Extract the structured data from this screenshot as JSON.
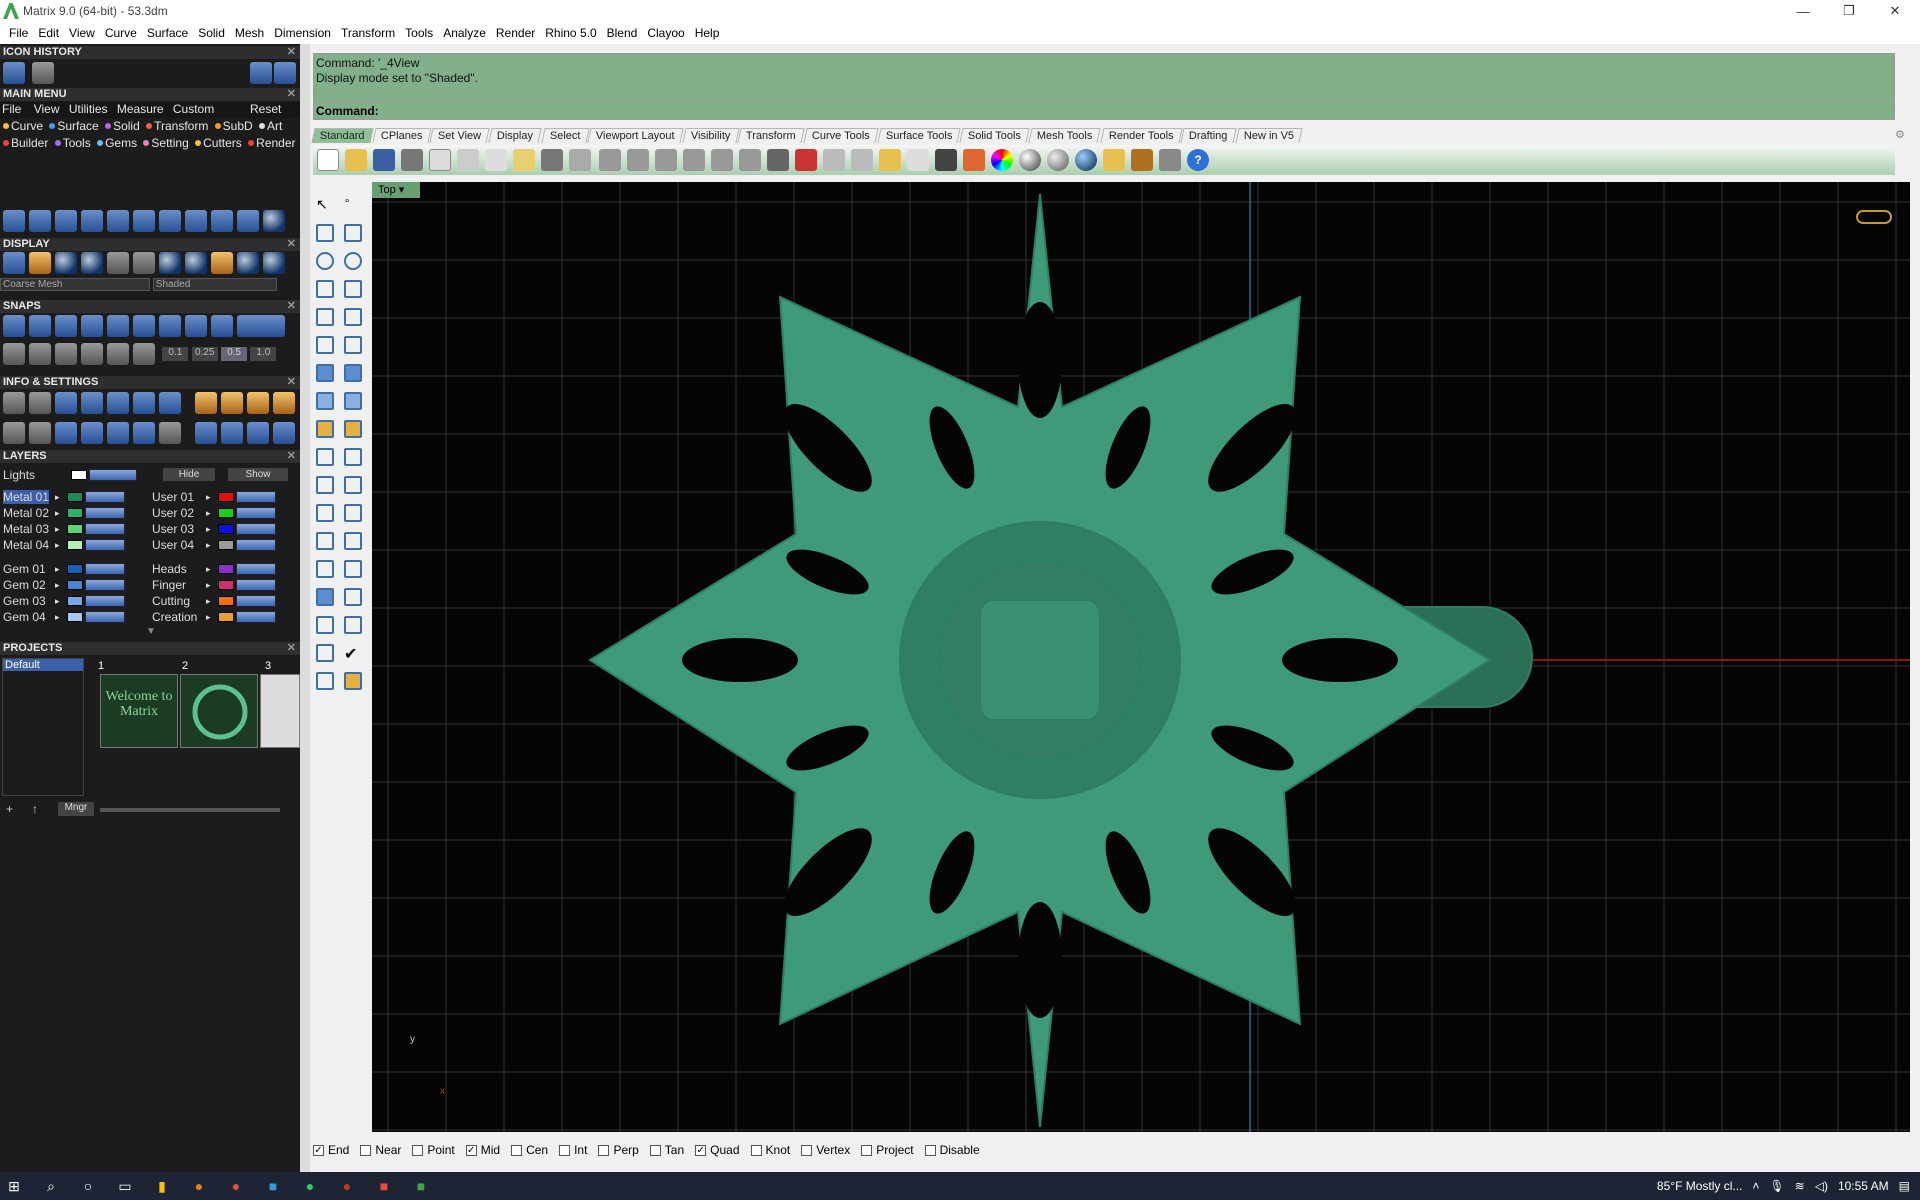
{
  "window": {
    "title": "Matrix 9.0 (64-bit) - 53.3dm",
    "minimize_icon": "minimize-icon",
    "restore_icon": "restore-icon",
    "close_icon": "close-icon"
  },
  "menu": [
    "File",
    "Edit",
    "View",
    "Curve",
    "Surface",
    "Solid",
    "Mesh",
    "Dimension",
    "Transform",
    "Tools",
    "Analyze",
    "Render",
    "Rhino 5.0",
    "Blend",
    "Clayoo",
    "Help"
  ],
  "panels": {
    "icon_history": "ICON HISTORY",
    "main_menu": "MAIN MENU",
    "main_menu_bar": [
      "File",
      "View",
      "Utilities",
      "Measure",
      "Custom"
    ],
    "main_menu_reset": "Reset",
    "main_menu_row1": [
      "Curve",
      "Surface",
      "Solid",
      "Transform",
      "SubD",
      "Art"
    ],
    "main_menu_row2": [
      "Builder",
      "Tools",
      "Gems",
      "Setting",
      "Cutters",
      "Render"
    ],
    "display": "DISPLAY",
    "display_left_select": "Coarse Mesh",
    "display_right_select": "Shaded",
    "snaps": "SNAPS",
    "snap_values": [
      "0.1",
      "0.25",
      "0.5",
      "1.0"
    ],
    "info_settings": "INFO & SETTINGS",
    "layers": "LAYERS",
    "lights": "Lights",
    "hide": "Hide",
    "show": "Show",
    "layers_left": [
      {
        "name": "Metal 01",
        "color": "#1e8a58"
      },
      {
        "name": "Metal 02",
        "color": "#2fb06e"
      },
      {
        "name": "Metal 03",
        "color": "#5fd27a"
      },
      {
        "name": "Metal 04",
        "color": "#b4ecbd"
      },
      {
        "name": "Gem 01",
        "color": "#1b5fb8"
      },
      {
        "name": "Gem 02",
        "color": "#4a86d8"
      },
      {
        "name": "Gem 03",
        "color": "#7aa8e6"
      },
      {
        "name": "Gem 04",
        "color": "#a7c6f0"
      }
    ],
    "layers_right": [
      {
        "name": "User 01",
        "color": "#e01010"
      },
      {
        "name": "User 02",
        "color": "#18d018"
      },
      {
        "name": "User 03",
        "color": "#1010e0"
      },
      {
        "name": "User 04",
        "color": "#9a9a9a"
      },
      {
        "name": "Heads",
        "color": "#8a30c8"
      },
      {
        "name": "Finger",
        "color": "#d03070"
      },
      {
        "name": "Cutting",
        "color": "#f07018"
      },
      {
        "name": "Creation",
        "color": "#e8a030"
      }
    ],
    "projects": "PROJECTS",
    "project_default": "Default",
    "thumb_numbers": [
      "1",
      "2",
      "3"
    ],
    "thumb1_text": "Welcome to Matrix",
    "mngr": "Mngr"
  },
  "command": {
    "line1": "Command: '_4View",
    "line2": "Display mode set to \"Shaded\".",
    "prompt": "Command:"
  },
  "tabs": [
    "Standard",
    "CPlanes",
    "Set View",
    "Display",
    "Select",
    "Viewport Layout",
    "Visibility",
    "Transform",
    "Curve Tools",
    "Surface Tools",
    "Solid Tools",
    "Mesh Tools",
    "Render Tools",
    "Drafting",
    "New in V5"
  ],
  "viewport": {
    "name": "Top",
    "axis_y": "y",
    "axis_x": "x"
  },
  "osnap": [
    {
      "label": "End",
      "checked": true
    },
    {
      "label": "Near",
      "checked": false
    },
    {
      "label": "Point",
      "checked": false
    },
    {
      "label": "Mid",
      "checked": true
    },
    {
      "label": "Cen",
      "checked": false
    },
    {
      "label": "Int",
      "checked": false
    },
    {
      "label": "Perp",
      "checked": false
    },
    {
      "label": "Tan",
      "checked": false
    },
    {
      "label": "Quad",
      "checked": true
    },
    {
      "label": "Knot",
      "checked": false
    },
    {
      "label": "Vertex",
      "checked": false
    },
    {
      "label": "Project",
      "checked": false
    },
    {
      "label": "Disable",
      "checked": false
    }
  ],
  "taskbar": {
    "weather": "85°F  Mostly cl...",
    "time": "10:55 AM"
  },
  "colors": {
    "accent": "#82b08a",
    "model": "#3e9a78",
    "grid": "#3a3a3a"
  }
}
